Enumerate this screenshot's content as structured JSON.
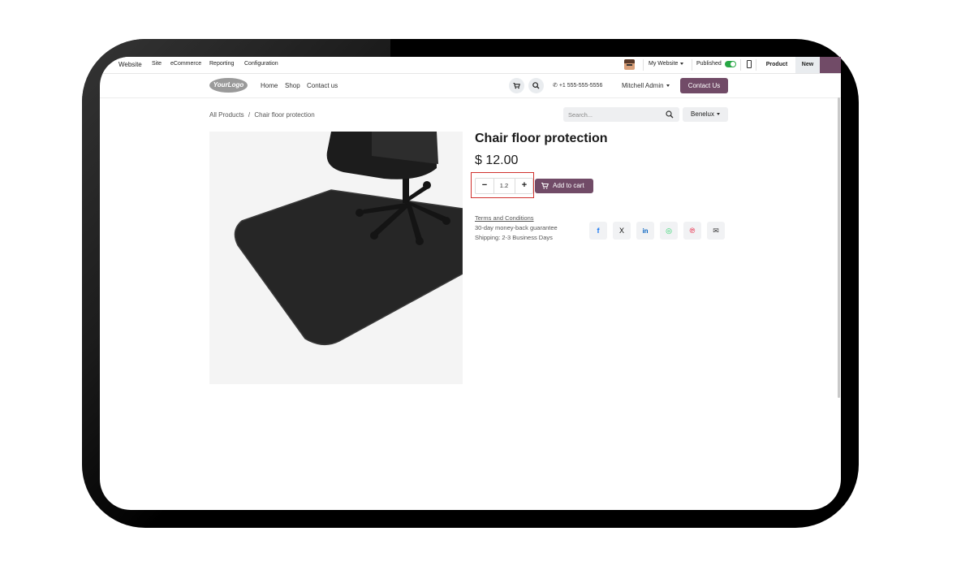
{
  "admin_bar": {
    "app_name": "Website",
    "menu": [
      "Site",
      "eCommerce",
      "Reporting",
      "Configuration"
    ],
    "website_selector": "My Website",
    "published_label": "Published",
    "published": true,
    "product_button": "Product",
    "new_button": "New"
  },
  "header": {
    "logo_text": "YourLogo",
    "nav": [
      "Home",
      "Shop",
      "Contact us"
    ],
    "phone": "+1 555-555-5556",
    "user": "Mitchell Admin",
    "contact_button": "Contact Us"
  },
  "breadcrumb": {
    "root": "All Products",
    "separator": "/",
    "current": "Chair floor protection"
  },
  "search": {
    "placeholder": "Search..."
  },
  "pricelist": "Benelux",
  "product": {
    "name": "Chair floor protection",
    "price": "$ 12.00",
    "quantity": "1.2",
    "add_to_cart": "Add to cart",
    "terms_link": "Terms and Conditions",
    "guarantee": "30-day money-back guarantee",
    "shipping": "Shipping: 2-3 Business Days"
  },
  "share_icons": [
    {
      "name": "facebook-icon",
      "glyph": "f",
      "color": "#1877f2"
    },
    {
      "name": "x-twitter-icon",
      "glyph": "X",
      "color": "#111111"
    },
    {
      "name": "linkedin-icon",
      "glyph": "in",
      "color": "#0a66c2"
    },
    {
      "name": "whatsapp-icon",
      "glyph": "◎",
      "color": "#25d366"
    },
    {
      "name": "pinterest-icon",
      "glyph": "℗",
      "color": "#e60023"
    },
    {
      "name": "email-icon",
      "glyph": "✉",
      "color": "#333333"
    }
  ],
  "colors": {
    "primary": "#714b67",
    "highlight": "#d0312d",
    "toggle_on": "#28a745"
  }
}
